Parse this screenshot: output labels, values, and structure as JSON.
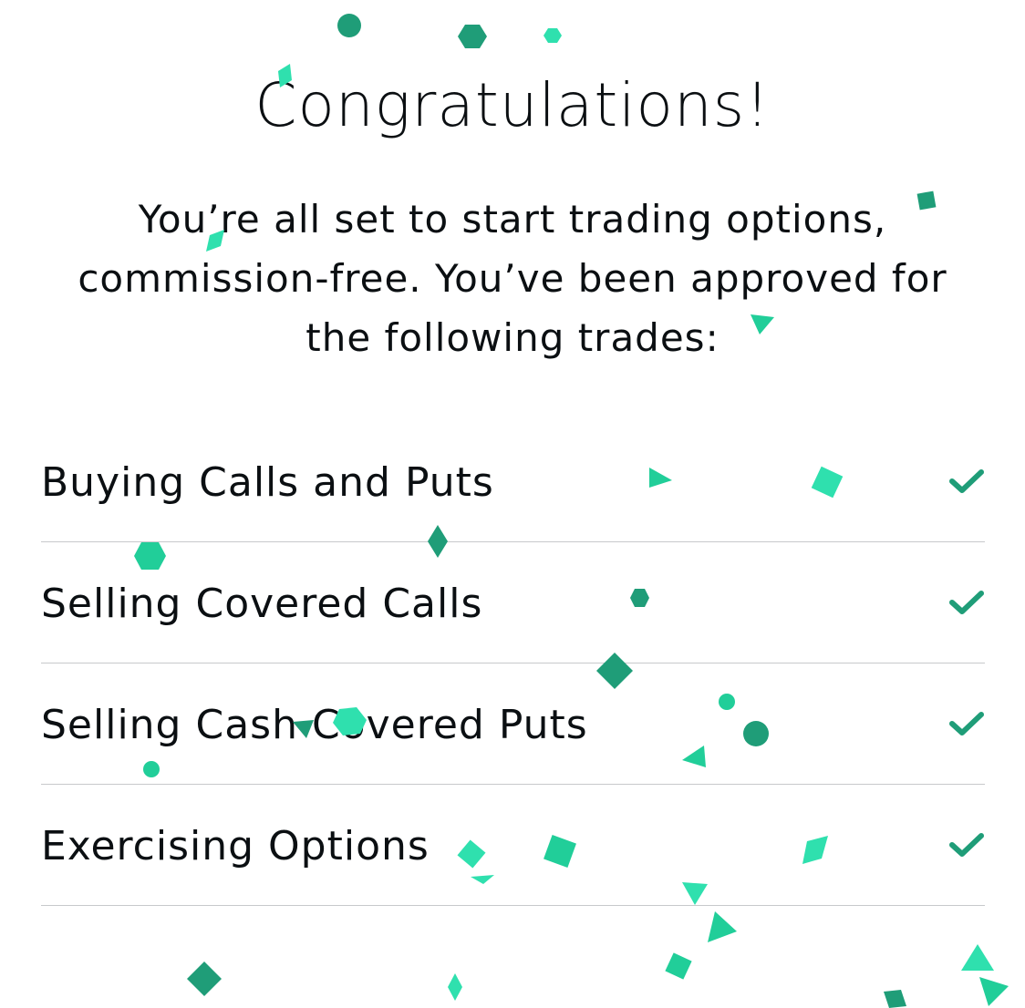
{
  "title": "Congratulations!",
  "subtitle": "You’re all set to start trading options, commission-free. You’ve been approved for the following trades:",
  "approved_trades": [
    {
      "label": "Buying Calls and Puts",
      "status_icon": "checkmark-icon"
    },
    {
      "label": "Selling Covered Calls",
      "status_icon": "checkmark-icon"
    },
    {
      "label": "Selling Cash Covered Puts",
      "status_icon": "checkmark-icon"
    },
    {
      "label": "Exercising Options",
      "status_icon": "checkmark-icon"
    }
  ],
  "colors": {
    "accent": "#21ce99",
    "accent_dark": "#1f9d78",
    "accent_light": "#2fe0ae",
    "text": "#0b0f12",
    "divider": "#c7c9cb",
    "background": "#ffffff"
  },
  "decoration": "confetti"
}
